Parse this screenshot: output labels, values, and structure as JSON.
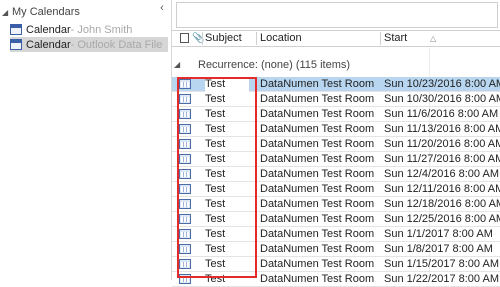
{
  "nav": {
    "group_label": "My Calendars",
    "items": [
      {
        "label": "Calendar",
        "suffix": " - John Smith"
      },
      {
        "label": "Calendar",
        "suffix": " - Outlook Data File"
      }
    ]
  },
  "columns": {
    "subject": "Subject",
    "location": "Location",
    "start": "Start"
  },
  "group": {
    "label": "Recurrence: (none) (115 items)"
  },
  "rows": [
    {
      "subject": "Test",
      "location": "DataNumen Test Room",
      "start": "Sun 10/23/2016 8:00 AM"
    },
    {
      "subject": "Test",
      "location": "DataNumen Test Room",
      "start": "Sun 10/30/2016 8:00 AM"
    },
    {
      "subject": "Test",
      "location": "DataNumen Test Room",
      "start": "Sun 11/6/2016 8:00 AM"
    },
    {
      "subject": "Test",
      "location": "DataNumen Test Room",
      "start": "Sun 11/13/2016 8:00 AM"
    },
    {
      "subject": "Test",
      "location": "DataNumen Test Room",
      "start": "Sun 11/20/2016 8:00 AM"
    },
    {
      "subject": "Test",
      "location": "DataNumen Test Room",
      "start": "Sun 11/27/2016 8:00 AM"
    },
    {
      "subject": "Test",
      "location": "DataNumen Test Room",
      "start": "Sun 12/4/2016 8:00 AM"
    },
    {
      "subject": "Test",
      "location": "DataNumen Test Room",
      "start": "Sun 12/11/2016 8:00 AM"
    },
    {
      "subject": "Test",
      "location": "DataNumen Test Room",
      "start": "Sun 12/18/2016 8:00 AM"
    },
    {
      "subject": "Test",
      "location": "DataNumen Test Room",
      "start": "Sun 12/25/2016 8:00 AM"
    },
    {
      "subject": "Test",
      "location": "DataNumen Test Room",
      "start": "Sun 1/1/2017 8:00 AM"
    },
    {
      "subject": "Test",
      "location": "DataNumen Test Room",
      "start": "Sun 1/8/2017 8:00 AM"
    },
    {
      "subject": "Test",
      "location": "DataNumen Test Room",
      "start": "Sun 1/15/2017 8:00 AM"
    },
    {
      "subject": "Test",
      "location": "DataNumen Test Room",
      "start": "Sun 1/22/2017 8:00 AM"
    }
  ],
  "colors": {
    "selected_row": "#b8d6f0",
    "highlight_box": "#e32b2b",
    "nav_selected": "#d6d6d6"
  }
}
